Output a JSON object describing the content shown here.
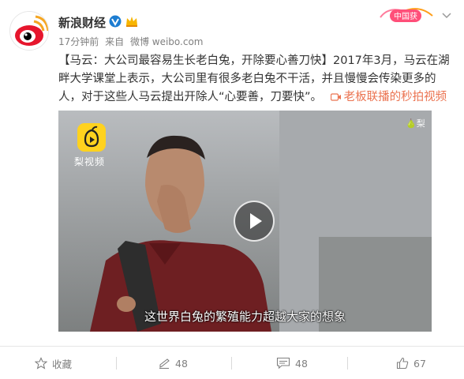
{
  "post": {
    "user": {
      "name": "新浪财经",
      "verified_icon": "verified-v-icon",
      "vip_icon": "vip-crown-icon"
    },
    "time": "17分钟前",
    "source_prefix": "来自",
    "source": "微博 weibo.com",
    "text": "【马云：大公司最容易生长老白兔，开除要心善刀快】2017年3月，马云在湖畔大学课堂上表示，大公司里有很多老白兔不干活，并且慢慢会传染更多的人，对于这些人马云提出开除人“心要善，刀要快”。",
    "video_link": "老板联播的秒拍视频",
    "badge_text": "中国获",
    "video": {
      "brand": "梨视频",
      "corner": "梨",
      "subtitle": "这世界白兔的繁殖能力超越大家的想象"
    }
  },
  "actions": {
    "favorite": "收藏",
    "repost": "48",
    "comment": "48",
    "like": "67"
  },
  "colors": {
    "link": "#eb7350",
    "meta": "#808080",
    "brand_yellow": "#ffd21e"
  }
}
